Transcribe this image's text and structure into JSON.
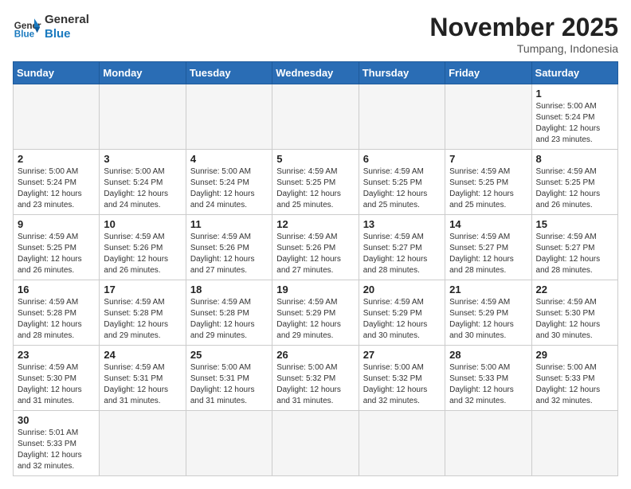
{
  "header": {
    "logo_general": "General",
    "logo_blue": "Blue",
    "month_title": "November 2025",
    "subtitle": "Tumpang, Indonesia"
  },
  "days_of_week": [
    "Sunday",
    "Monday",
    "Tuesday",
    "Wednesday",
    "Thursday",
    "Friday",
    "Saturday"
  ],
  "weeks": [
    [
      {
        "day": "",
        "info": ""
      },
      {
        "day": "",
        "info": ""
      },
      {
        "day": "",
        "info": ""
      },
      {
        "day": "",
        "info": ""
      },
      {
        "day": "",
        "info": ""
      },
      {
        "day": "",
        "info": ""
      },
      {
        "day": "1",
        "info": "Sunrise: 5:00 AM\nSunset: 5:24 PM\nDaylight: 12 hours and 23 minutes."
      }
    ],
    [
      {
        "day": "2",
        "info": "Sunrise: 5:00 AM\nSunset: 5:24 PM\nDaylight: 12 hours and 23 minutes."
      },
      {
        "day": "3",
        "info": "Sunrise: 5:00 AM\nSunset: 5:24 PM\nDaylight: 12 hours and 24 minutes."
      },
      {
        "day": "4",
        "info": "Sunrise: 5:00 AM\nSunset: 5:24 PM\nDaylight: 12 hours and 24 minutes."
      },
      {
        "day": "5",
        "info": "Sunrise: 4:59 AM\nSunset: 5:25 PM\nDaylight: 12 hours and 25 minutes."
      },
      {
        "day": "6",
        "info": "Sunrise: 4:59 AM\nSunset: 5:25 PM\nDaylight: 12 hours and 25 minutes."
      },
      {
        "day": "7",
        "info": "Sunrise: 4:59 AM\nSunset: 5:25 PM\nDaylight: 12 hours and 25 minutes."
      },
      {
        "day": "8",
        "info": "Sunrise: 4:59 AM\nSunset: 5:25 PM\nDaylight: 12 hours and 26 minutes."
      }
    ],
    [
      {
        "day": "9",
        "info": "Sunrise: 4:59 AM\nSunset: 5:25 PM\nDaylight: 12 hours and 26 minutes."
      },
      {
        "day": "10",
        "info": "Sunrise: 4:59 AM\nSunset: 5:26 PM\nDaylight: 12 hours and 26 minutes."
      },
      {
        "day": "11",
        "info": "Sunrise: 4:59 AM\nSunset: 5:26 PM\nDaylight: 12 hours and 27 minutes."
      },
      {
        "day": "12",
        "info": "Sunrise: 4:59 AM\nSunset: 5:26 PM\nDaylight: 12 hours and 27 minutes."
      },
      {
        "day": "13",
        "info": "Sunrise: 4:59 AM\nSunset: 5:27 PM\nDaylight: 12 hours and 28 minutes."
      },
      {
        "day": "14",
        "info": "Sunrise: 4:59 AM\nSunset: 5:27 PM\nDaylight: 12 hours and 28 minutes."
      },
      {
        "day": "15",
        "info": "Sunrise: 4:59 AM\nSunset: 5:27 PM\nDaylight: 12 hours and 28 minutes."
      }
    ],
    [
      {
        "day": "16",
        "info": "Sunrise: 4:59 AM\nSunset: 5:28 PM\nDaylight: 12 hours and 28 minutes."
      },
      {
        "day": "17",
        "info": "Sunrise: 4:59 AM\nSunset: 5:28 PM\nDaylight: 12 hours and 29 minutes."
      },
      {
        "day": "18",
        "info": "Sunrise: 4:59 AM\nSunset: 5:28 PM\nDaylight: 12 hours and 29 minutes."
      },
      {
        "day": "19",
        "info": "Sunrise: 4:59 AM\nSunset: 5:29 PM\nDaylight: 12 hours and 29 minutes."
      },
      {
        "day": "20",
        "info": "Sunrise: 4:59 AM\nSunset: 5:29 PM\nDaylight: 12 hours and 30 minutes."
      },
      {
        "day": "21",
        "info": "Sunrise: 4:59 AM\nSunset: 5:29 PM\nDaylight: 12 hours and 30 minutes."
      },
      {
        "day": "22",
        "info": "Sunrise: 4:59 AM\nSunset: 5:30 PM\nDaylight: 12 hours and 30 minutes."
      }
    ],
    [
      {
        "day": "23",
        "info": "Sunrise: 4:59 AM\nSunset: 5:30 PM\nDaylight: 12 hours and 31 minutes."
      },
      {
        "day": "24",
        "info": "Sunrise: 4:59 AM\nSunset: 5:31 PM\nDaylight: 12 hours and 31 minutes."
      },
      {
        "day": "25",
        "info": "Sunrise: 5:00 AM\nSunset: 5:31 PM\nDaylight: 12 hours and 31 minutes."
      },
      {
        "day": "26",
        "info": "Sunrise: 5:00 AM\nSunset: 5:32 PM\nDaylight: 12 hours and 31 minutes."
      },
      {
        "day": "27",
        "info": "Sunrise: 5:00 AM\nSunset: 5:32 PM\nDaylight: 12 hours and 32 minutes."
      },
      {
        "day": "28",
        "info": "Sunrise: 5:00 AM\nSunset: 5:33 PM\nDaylight: 12 hours and 32 minutes."
      },
      {
        "day": "29",
        "info": "Sunrise: 5:00 AM\nSunset: 5:33 PM\nDaylight: 12 hours and 32 minutes."
      }
    ],
    [
      {
        "day": "30",
        "info": "Sunrise: 5:01 AM\nSunset: 5:33 PM\nDaylight: 12 hours and 32 minutes."
      },
      {
        "day": "",
        "info": ""
      },
      {
        "day": "",
        "info": ""
      },
      {
        "day": "",
        "info": ""
      },
      {
        "day": "",
        "info": ""
      },
      {
        "day": "",
        "info": ""
      },
      {
        "day": "",
        "info": ""
      }
    ]
  ]
}
